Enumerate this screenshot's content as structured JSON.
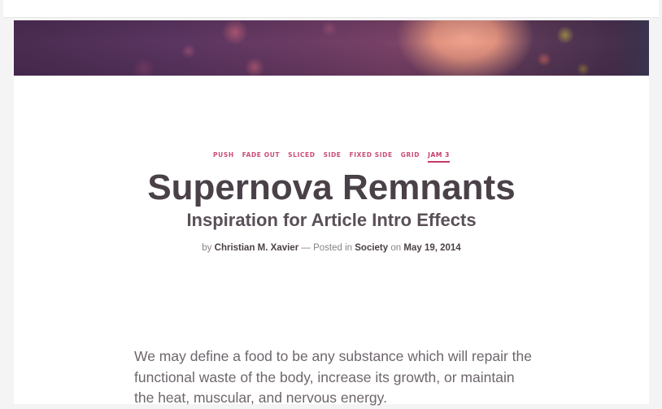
{
  "nav": {
    "links": [
      {
        "label": "PUSH"
      },
      {
        "label": "FADE OUT"
      },
      {
        "label": "SLICED"
      },
      {
        "label": "SIDE"
      },
      {
        "label": "FIXED SIDE"
      },
      {
        "label": "GRID"
      },
      {
        "label": "JAM 3",
        "current": true
      }
    ]
  },
  "header": {
    "title": "Supernova Remnants",
    "subtitle": "Inspiration for Article Intro Effects"
  },
  "meta": {
    "by_prefix": "by",
    "author": "Christian M. Xavier",
    "posted_prefix": "— Posted in",
    "category": "Society",
    "date_prefix": "on",
    "date": "May 19, 2014"
  },
  "article": {
    "paragraph": "We may define a food to be any substance which will repair the functional waste of the body, increase its growth, or maintain the heat, muscular, and nervous energy."
  },
  "colors": {
    "accent": "#c53b68",
    "title": "#4a4148",
    "text": "#6e666c"
  }
}
